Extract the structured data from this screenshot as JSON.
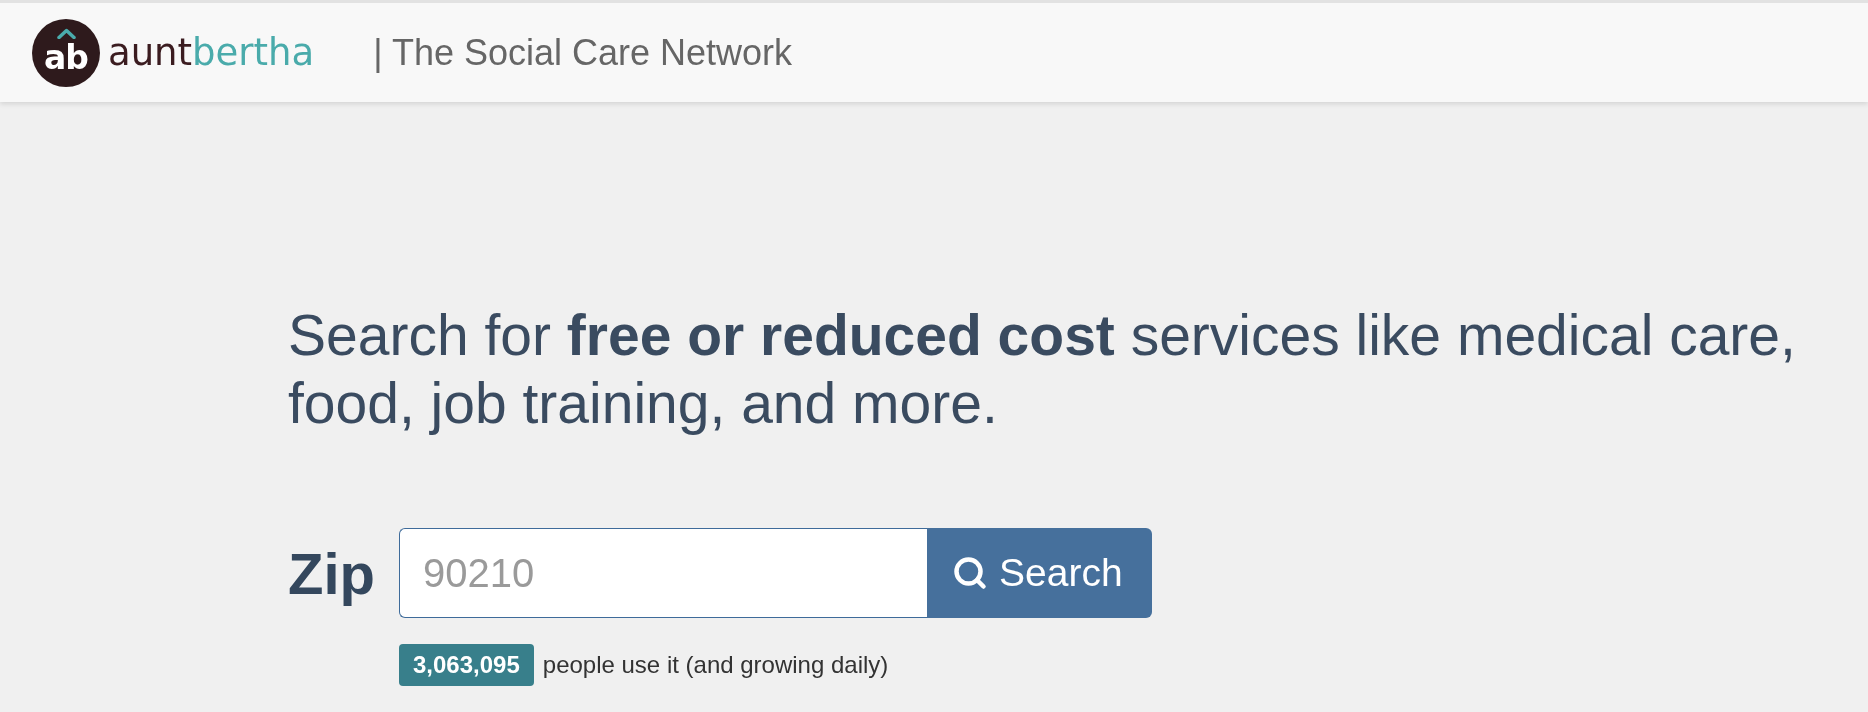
{
  "header": {
    "logo": {
      "monogram": "ab",
      "wordmark": [
        {
          "text": "aunt",
          "color": "#3b1c20"
        },
        {
          "text": "bertha",
          "color": "#4aabab"
        }
      ]
    },
    "tagline": "| The Social Care Network"
  },
  "hero": {
    "headline": "Search for **free or reduced cost** services like medical care, food, job training, and more.",
    "search": {
      "label": "Zip",
      "placeholder": "90210",
      "button": "Search"
    },
    "stats": {
      "count": "3,063,095",
      "text": "people use it (and growing daily)"
    }
  }
}
